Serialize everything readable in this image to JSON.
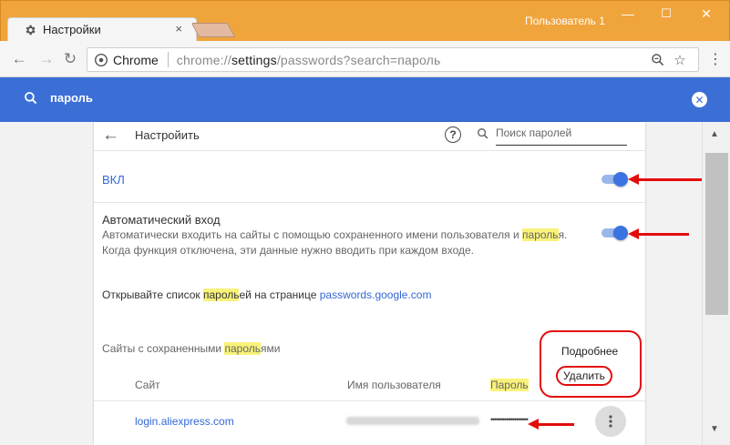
{
  "window": {
    "user": "Пользователь 1",
    "minimize": "—",
    "maximize": "☐",
    "close": "✕"
  },
  "tab": {
    "title": "Настройки",
    "close": "×"
  },
  "toolbar": {
    "back": "←",
    "forward": "→",
    "reload": "↻",
    "chip": "Chrome",
    "url_scheme": "chrome://",
    "url_host": "settings",
    "url_rest": "/passwords?search=пароль"
  },
  "search": {
    "query": "пароль",
    "clear": "✕"
  },
  "header": {
    "back": "←",
    "title": "Настройить",
    "help": "?",
    "search_placeholder": "Поиск паролей"
  },
  "sections": {
    "enabled_label": "ВКЛ",
    "auto_signin_title": "Автоматический вход",
    "auto_signin_desc_1_pre": "Автоматически входить на сайты с помощью сохраненного имени пользователя и ",
    "auto_signin_desc_1_hl": "пароль",
    "auto_signin_desc_1_post": "я.",
    "auto_signin_desc_2": "Когда функция отключена, эти данные нужно вводить при каждом входе.",
    "open_list_pre": "Открывайте список ",
    "open_list_hl": "пароль",
    "open_list_mid": "ей на странице ",
    "open_list_link": "passwords.google.com",
    "saved_pre": "Сайты с сохраненными ",
    "saved_hl": "пароль",
    "saved_post": "ями"
  },
  "table": {
    "col_site": "Сайт",
    "col_user": "Имя пользователя",
    "col_pass_hl": "Пароль",
    "rows": [
      {
        "site": "login.aliexpress.com",
        "user": "",
        "password": "•••••••••••••••••••"
      }
    ]
  },
  "menu": {
    "details": "Подробнее",
    "delete": "Удалить"
  },
  "scroll": {
    "up": "▲",
    "down": "▼"
  },
  "colors": {
    "accent": "#3b6fd6",
    "titlebar": "#f0a43c",
    "annotation": "#e40b0b",
    "highlight": "#f9f27a"
  }
}
